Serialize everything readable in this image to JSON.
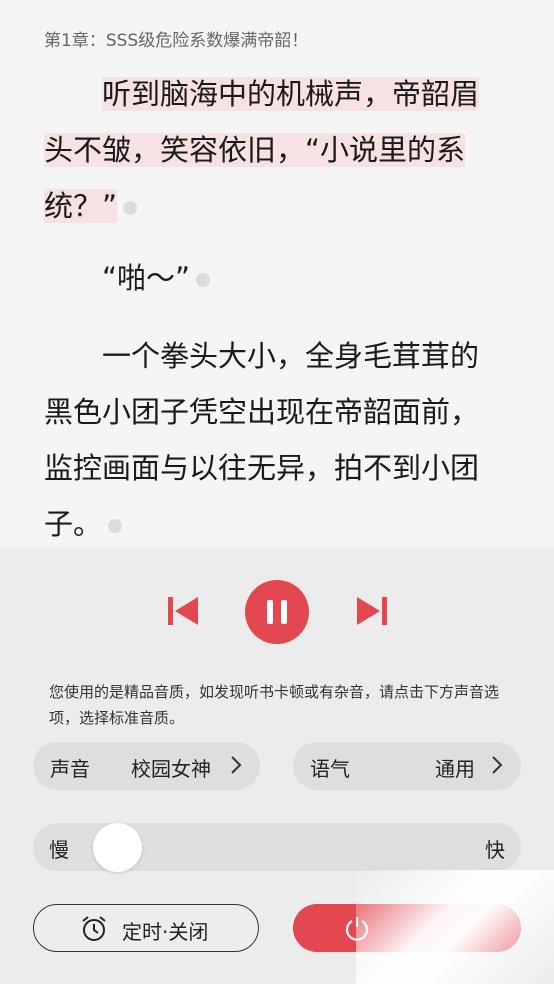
{
  "chapter_title": "第1章：SSS级危险系数爆满帝韶！",
  "paragraphs": [
    {
      "lines": [
        "听到脑海中的机械声，帝韶眉",
        "头不皱，笑容依旧，“小说里的系",
        "统？”"
      ],
      "highlighted": true
    },
    {
      "lines": [
        "“啪～”"
      ],
      "highlighted": false
    },
    {
      "lines": [
        "一个拳头大小，全身毛茸茸的",
        "黑色小团子凭空出现在帝韶面前，",
        "监控画面与以往无异，拍不到小团",
        "子。"
      ],
      "highlighted": false
    }
  ],
  "player": {
    "prev_icon": "skip-previous-icon",
    "pause_icon": "pause-icon",
    "next_icon": "skip-next-icon",
    "notice": "您使用的是精品音质，如发现听书卡顿或有杂音，请点击下方声音选项，选择标准音质。",
    "voice": {
      "label": "声音",
      "value": "校园女神"
    },
    "tone": {
      "label": "语气",
      "value": "通用"
    },
    "speed": {
      "slow_label": "慢",
      "fast_label": "快",
      "level": 0.12
    },
    "timer": {
      "label": "定时·关闭",
      "icon": "alarm-clock-icon"
    },
    "power_icon": "power-icon",
    "accent_color": "#e3474f",
    "highlight_color": "#f6e1e3"
  }
}
